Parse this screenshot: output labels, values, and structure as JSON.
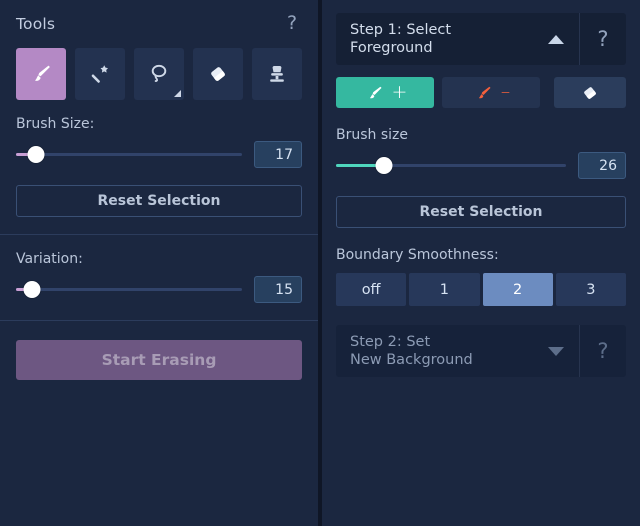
{
  "left_panel": {
    "title": "Tools",
    "help_label": "?",
    "tools": [
      {
        "name": "brush-tool",
        "icon": "paintbrush-icon",
        "selected": true,
        "has_submenu": false
      },
      {
        "name": "magic-wand-tool",
        "icon": "magic-wand-icon",
        "selected": false,
        "has_submenu": false
      },
      {
        "name": "lasso-tool",
        "icon": "lasso-icon",
        "selected": false,
        "has_submenu": true
      },
      {
        "name": "eraser-tool",
        "icon": "eraser-icon",
        "selected": false,
        "has_submenu": false
      },
      {
        "name": "clone-stamp-tool",
        "icon": "stamp-icon",
        "selected": false,
        "has_submenu": false
      }
    ],
    "brush_size": {
      "label": "Brush Size:",
      "value": "17",
      "percent": 9
    },
    "reset_selection_label": "Reset Selection",
    "variation": {
      "label": "Variation:",
      "value": "15",
      "percent": 7
    },
    "start_erasing_label": "Start Erasing"
  },
  "right_panel": {
    "step1": {
      "title": "Step 1: Select\nForeground",
      "title_line1": "Step 1: Select",
      "title_line2": "Foreground",
      "expanded": true,
      "collapse_arrow": "triangle-up",
      "help_label": "?"
    },
    "modes": [
      {
        "name": "add-foreground",
        "label": "+",
        "icon": "paintbrush-icon",
        "selected": true,
        "color": "#35b8a0"
      },
      {
        "name": "remove-foreground",
        "label": "–",
        "icon": "paintbrush-icon",
        "selected": false,
        "color": "#f4603c"
      },
      {
        "name": "eraser",
        "label": "",
        "icon": "eraser-icon",
        "selected": false,
        "color": "#2b3d5c"
      }
    ],
    "brush_size": {
      "label": "Brush size",
      "value": "26",
      "percent": 21
    },
    "reset_selection_label": "Reset Selection",
    "boundary_smoothness": {
      "label": "Boundary Smoothness:",
      "options": [
        "off",
        "1",
        "2",
        "3"
      ],
      "selected_index": 2
    },
    "step2": {
      "title_line1": "Step 2: Set",
      "title_line2": "New Background",
      "expanded": false,
      "collapse_arrow": "triangle-down",
      "help_label": "?"
    }
  },
  "colors": {
    "panel_bg": "#1b2740",
    "accent_pink": "#b489c5",
    "accent_teal": "#35b8a0",
    "accent_red": "#f4603c",
    "segment_selected": "#6c8cc0",
    "primary_button": "#6d5782"
  }
}
